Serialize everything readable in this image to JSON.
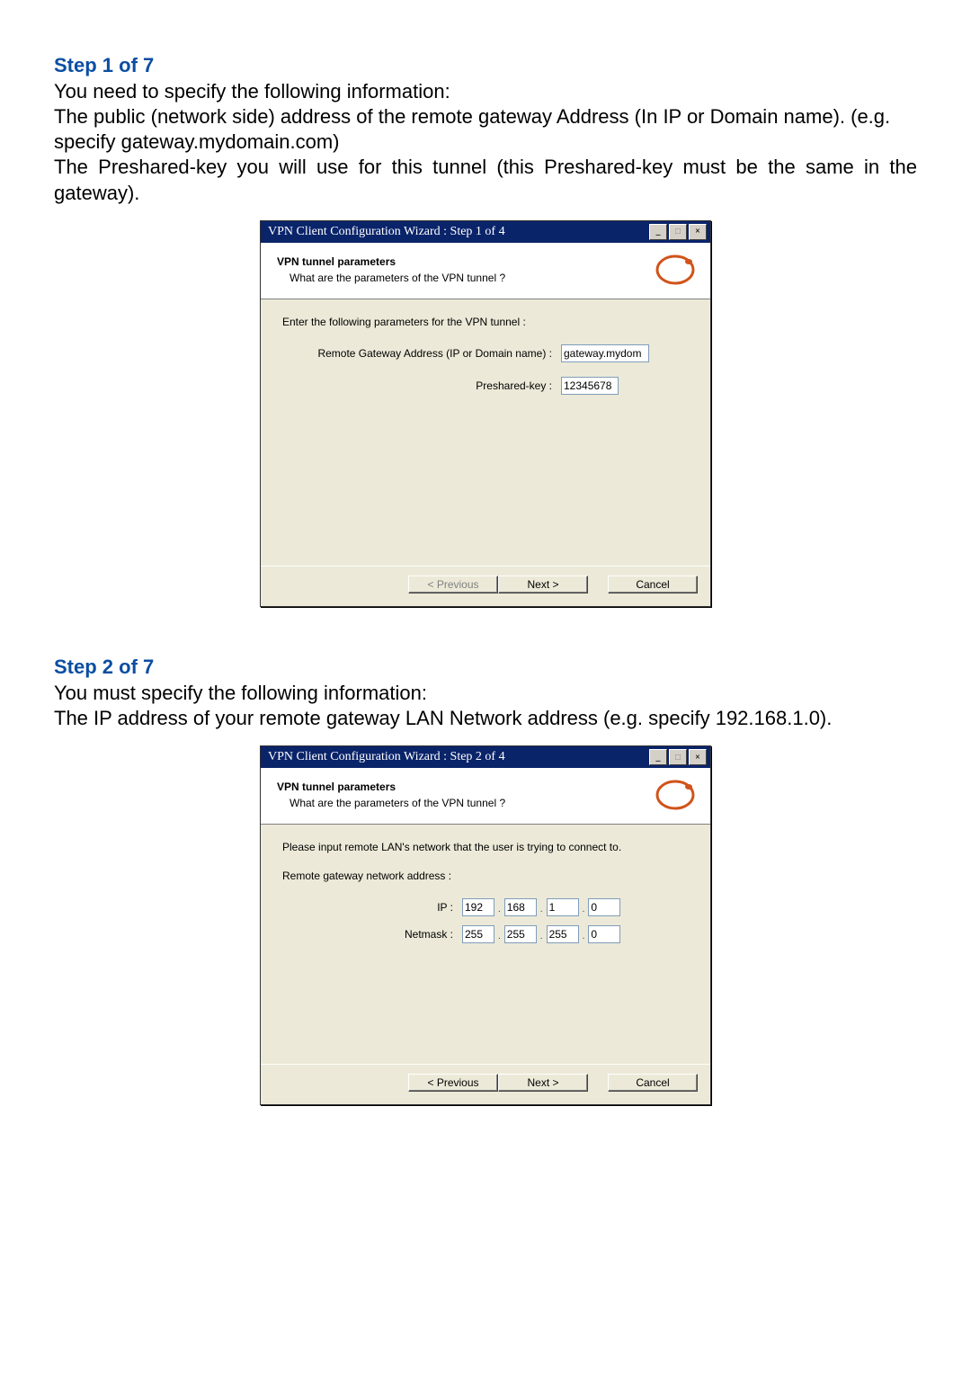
{
  "section1": {
    "heading": "Step 1 of 7",
    "line1": "You need to specify the following information:",
    "line2": "The public (network side) address of the remote gateway Address (In IP or Domain name). (e.g. specify gateway.mydomain.com)",
    "line3": "The Preshared-key you will use for this tunnel (this Preshared-key must be the same in the gateway)."
  },
  "dlg1": {
    "title": "VPN Client Configuration Wizard : Step 1 of 4",
    "h_bold": "VPN tunnel parameters",
    "h_sub": "What are the parameters of the VPN tunnel ?",
    "body_intro": "Enter the following parameters for the VPN tunnel :",
    "lbl_gateway": "Remote Gateway Address (IP or Domain name) :",
    "val_gateway": "gateway.mydom",
    "lbl_psk": "Preshared-key :",
    "val_psk": "12345678",
    "btn_prev": "< Previous",
    "btn_next": "Next >",
    "btn_cancel": "Cancel",
    "ctrl_min": "_",
    "ctrl_max": "□",
    "ctrl_close": "×"
  },
  "section2": {
    "heading": "Step 2 of 7",
    "line1": "You must specify the following information:",
    "line2": "The IP address of your remote gateway LAN Network address (e.g. specify 192.168.1.0)."
  },
  "dlg2": {
    "title": "VPN Client Configuration Wizard : Step 2 of 4",
    "h_bold": "VPN tunnel parameters",
    "h_sub": "What are the parameters of the VPN tunnel ?",
    "body_intro": "Please input remote LAN's network that the user is trying to connect to.",
    "lbl_netaddr": "Remote gateway network address :",
    "lbl_ip": "IP :",
    "ip": [
      "192",
      "168",
      "1",
      "0"
    ],
    "lbl_netmask": "Netmask :",
    "netmask": [
      "255",
      "255",
      "255",
      "0"
    ],
    "btn_prev": "< Previous",
    "btn_next": "Next >",
    "btn_cancel": "Cancel",
    "ctrl_min": "_",
    "ctrl_max": "□",
    "ctrl_close": "×"
  }
}
